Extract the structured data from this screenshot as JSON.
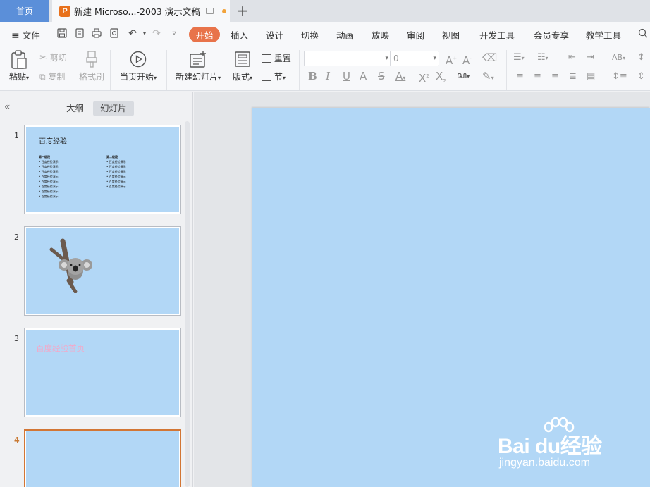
{
  "tabs": {
    "home": "首页",
    "doc_title": "新建 Microso...-2003 演示文稿",
    "doc_logo": "P"
  },
  "menu": {
    "file": "文件",
    "items": [
      "开始",
      "插入",
      "设计",
      "切换",
      "动画",
      "放映",
      "审阅",
      "视图",
      "开发工具",
      "会员专享",
      "教学工具"
    ],
    "active": "开始"
  },
  "ribbon": {
    "paste": "粘贴",
    "cut": "剪切",
    "copy": "复制",
    "format_painter": "格式刷",
    "play_from_current": "当页开始",
    "new_slide": "新建幻灯片",
    "layout": "版式",
    "reset": "重置",
    "section": "节",
    "font_size_value": "0"
  },
  "sidepanel": {
    "tab_outline": "大纲",
    "tab_slides": "幻灯片",
    "active_tab": "幻灯片"
  },
  "slides": [
    {
      "number": "1",
      "title": "百度经验",
      "col1_head": "第一级段",
      "col2_head": "第二级段",
      "bullet": "• 百度经验演示"
    },
    {
      "number": "2"
    },
    {
      "number": "3",
      "title": "百度经验首页"
    },
    {
      "number": "4"
    }
  ],
  "current_slide": "4",
  "watermark": {
    "logo": "Bai du经验",
    "url": "jingyan.baidu.com"
  },
  "colors": {
    "slide_bg": "#b2d7f6",
    "accent": "#e8734a",
    "home_tab": "#5b8fd9",
    "selected_border": "#d27635"
  }
}
